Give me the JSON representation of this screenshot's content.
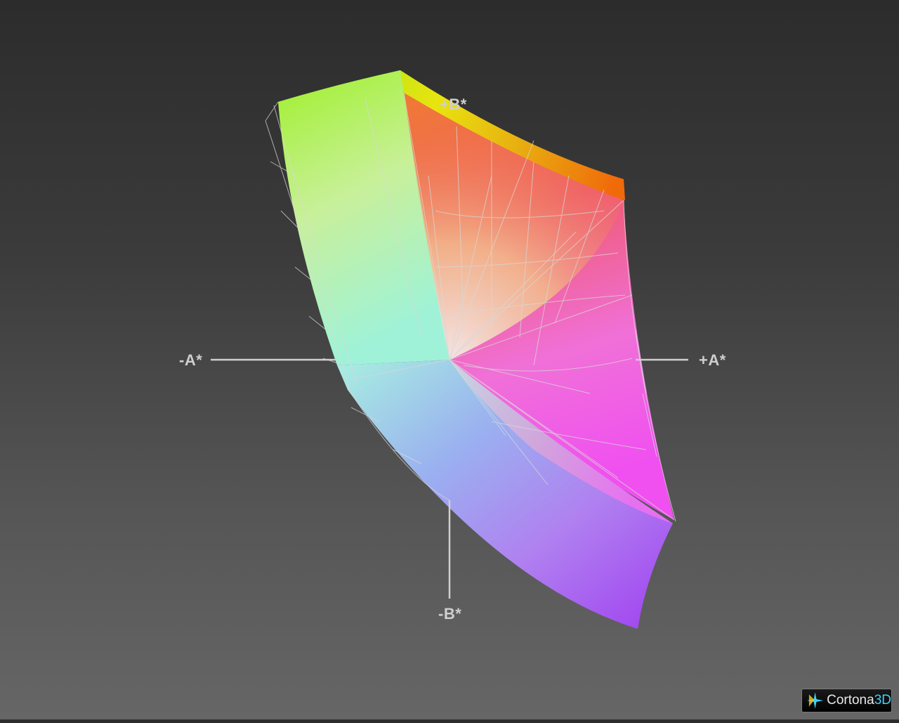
{
  "viewer": {
    "axes": {
      "a_negative": "-A*",
      "a_positive": "+A*",
      "b_positive": "+B*",
      "b_negative": "-B*"
    },
    "logo": {
      "brand": "Cortona",
      "suffix": "3D"
    }
  },
  "colors": {
    "background_top": "#2c2c2c",
    "background_bottom": "#666666",
    "axis": "#cfcfcf",
    "wireframe": "#d8d8d8",
    "logo_accent": "#3fd0ff"
  }
}
